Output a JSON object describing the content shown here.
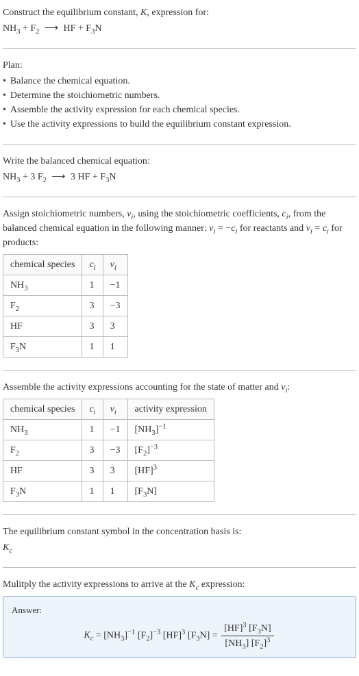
{
  "intro": {
    "line1": "Construct the equilibrium constant, K, expression for:",
    "equation": "NH₃ + F₂ ⟶ HF + F₃N"
  },
  "plan": {
    "title": "Plan:",
    "items": [
      "Balance the chemical equation.",
      "Determine the stoichiometric numbers.",
      "Assemble the activity expression for each chemical species.",
      "Use the activity expressions to build the equilibrium constant expression."
    ]
  },
  "balanced": {
    "title": "Write the balanced chemical equation:",
    "equation": "NH₃ + 3 F₂ ⟶ 3 HF + F₃N"
  },
  "stoich_intro": {
    "part1": "Assign stoichiometric numbers, νᵢ, using the stoichiometric coefficients, cᵢ, from the balanced chemical equation in the following manner: νᵢ = −cᵢ for reactants and νᵢ = cᵢ for products:"
  },
  "table1": {
    "headers": [
      "chemical species",
      "cᵢ",
      "νᵢ"
    ],
    "rows": [
      [
        "NH₃",
        "1",
        "−1"
      ],
      [
        "F₂",
        "3",
        "−3"
      ],
      [
        "HF",
        "3",
        "3"
      ],
      [
        "F₃N",
        "1",
        "1"
      ]
    ]
  },
  "activity_intro": "Assemble the activity expressions accounting for the state of matter and νᵢ:",
  "table2": {
    "headers": [
      "chemical species",
      "cᵢ",
      "νᵢ",
      "activity expression"
    ],
    "rows": [
      {
        "species": "NH₃",
        "ci": "1",
        "vi": "−1",
        "expr_base": "[NH₃]",
        "expr_sup": "−1"
      },
      {
        "species": "F₂",
        "ci": "3",
        "vi": "−3",
        "expr_base": "[F₂]",
        "expr_sup": "−3"
      },
      {
        "species": "HF",
        "ci": "3",
        "vi": "3",
        "expr_base": "[HF]",
        "expr_sup": "3"
      },
      {
        "species": "F₃N",
        "ci": "1",
        "vi": "1",
        "expr_base": "[F₃N]",
        "expr_sup": ""
      }
    ]
  },
  "symbol_intro": "The equilibrium constant symbol in the concentration basis is:",
  "symbol": "K_c",
  "multiply_intro": "Mulitply the activity expressions to arrive at the K_c expression:",
  "answer": {
    "label": "Answer:",
    "lhs": "K_c = [NH₃]⁻¹ [F₂]⁻³ [HF]³ [F₃N] =",
    "num": "[HF]³ [F₃N]",
    "den": "[NH₃] [F₂]³"
  }
}
